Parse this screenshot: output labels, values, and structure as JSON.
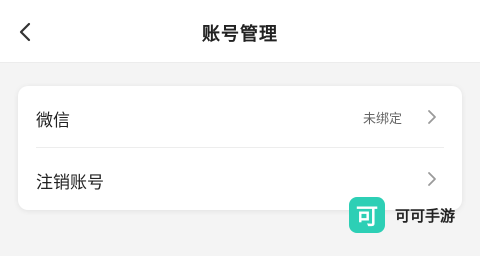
{
  "header": {
    "title": "账号管理",
    "back_icon": "chevron-left-icon"
  },
  "settings": {
    "items": [
      {
        "label": "微信",
        "status": "未绑定",
        "icon": "chevron-right-icon"
      },
      {
        "label": "注销账号",
        "icon": "chevron-right-icon"
      }
    ]
  },
  "watermark": {
    "logo_char": "可",
    "text": "可可手游",
    "color": "#2dcfb5"
  }
}
